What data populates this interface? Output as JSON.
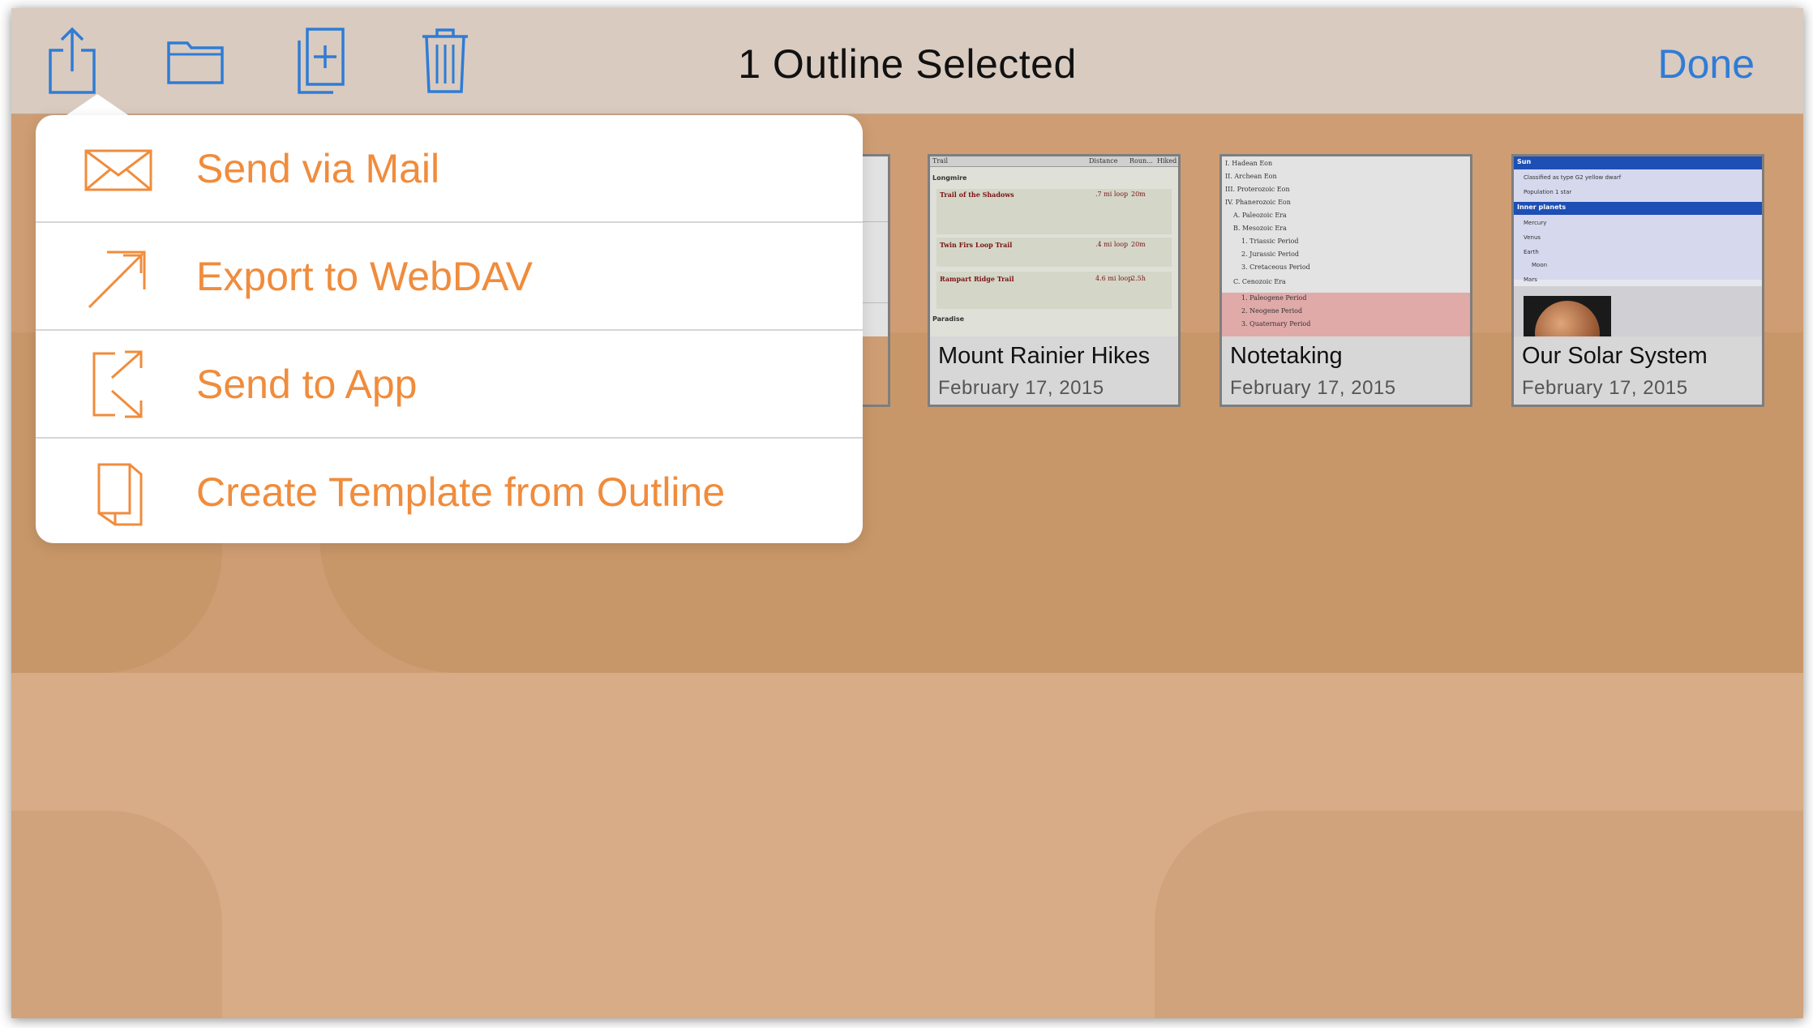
{
  "toolbar": {
    "title": "1 Outline Selected",
    "done_label": "Done",
    "icons": [
      "share-icon",
      "folder-icon",
      "duplicate-icon",
      "trash-icon"
    ]
  },
  "share_menu": {
    "items": [
      {
        "label": "Send via Mail",
        "icon": "mail-icon"
      },
      {
        "label": "Export to WebDAV",
        "icon": "export-arrow-icon"
      },
      {
        "label": "Send to App",
        "icon": "send-to-app-icon"
      },
      {
        "label": "Create Template from Outline",
        "icon": "template-icon"
      }
    ]
  },
  "documents": [
    {
      "name": "Mount Rainier Hikes",
      "date": "February 17, 2015",
      "preview": {
        "columns": [
          "Trail",
          "Distance",
          "Roun...",
          "Hiked"
        ],
        "rows": [
          {
            "text": "Longmire",
            "distance": "",
            "time": ""
          },
          {
            "text": "Trail of the Shadows",
            "distance": ".7 mi loop",
            "time": "20m"
          },
          {
            "text": "Twin Firs Loop Trail",
            "distance": ".4 mi loop",
            "time": "20m"
          },
          {
            "text": "Rampart Ridge Trail",
            "distance": "4.6 mi loop",
            "time": "2.5h"
          },
          {
            "text": "Paradise",
            "distance": "",
            "time": ""
          }
        ]
      }
    },
    {
      "name": "Notetaking",
      "date": "February 17, 2015",
      "preview": {
        "rows": [
          "I. Hadean Eon",
          "II. Archean Eon",
          "III. Proterozoic Eon",
          "IV. Phanerozoic Eon",
          "A. Paleozoic Era",
          "B. Mesozoic Era",
          "1. Triassic Period",
          "2. Jurassic Period",
          "3. Cretaceous Period",
          "C. Cenozoic Era",
          "1. Paleogene Period",
          "2. Neogene Period",
          "3. Quaternary Period"
        ]
      }
    },
    {
      "name": "Our Solar System",
      "date": "February 17, 2015",
      "preview": {
        "rows": [
          "Sun",
          "Classified as type G2 yellow dwarf",
          "Population 1 star",
          "Inner planets",
          "Mercury",
          "Venus",
          "Earth",
          "Moon",
          "Mars"
        ]
      }
    }
  ],
  "colors": {
    "accent_orange": "#f08c3c",
    "done_blue": "#2f7cd6",
    "icon_blue": "#2f7cd6",
    "background": "#cf9d73"
  }
}
